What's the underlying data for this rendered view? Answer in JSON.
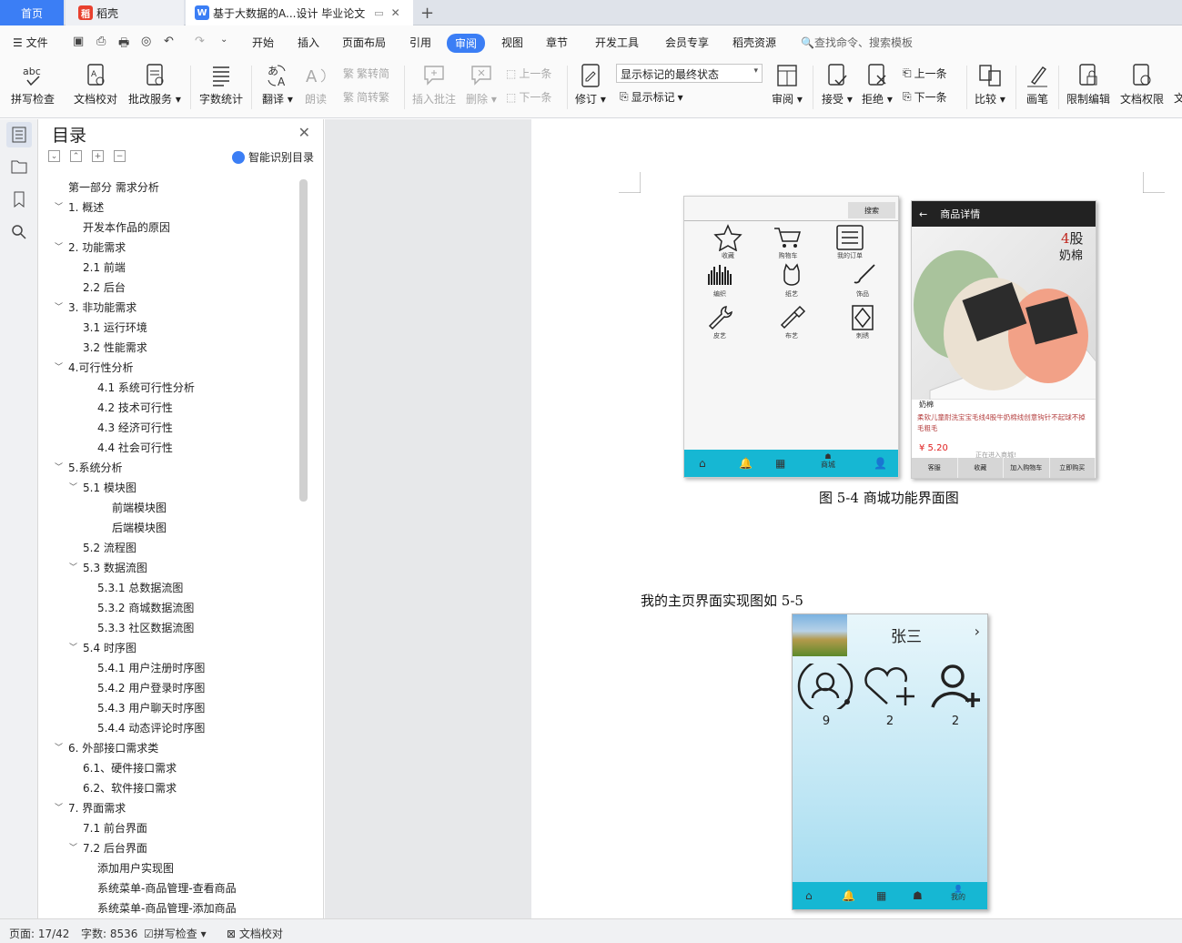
{
  "tabs": {
    "home": "首页",
    "docer": "稻壳",
    "doc": "基于大数据的A...设计 毕业论文",
    "new_tab": "+"
  },
  "menu": {
    "file": "文件",
    "items": [
      "开始",
      "插入",
      "页面布局",
      "引用",
      "审阅",
      "视图",
      "章节",
      "开发工具",
      "会员专享",
      "稻壳资源"
    ],
    "search_placeholder": "查找命令、搜索模板"
  },
  "ribbon": {
    "spell": "拼写检查",
    "proof": "文档校对",
    "batch": "批改服务",
    "wordcount": "字数统计",
    "translate": "翻译",
    "read": "朗读",
    "s2t": "繁转简",
    "t2s": "简转繁",
    "insert_comment": "插入批注",
    "delete": "删除",
    "prev_comment": "上一条",
    "next_comment": "下一条",
    "revise": "修订",
    "markup_state": "显示标记的最终状态",
    "show_markup": "显示标记",
    "review": "审阅",
    "accept": "接受",
    "reject": "拒绝",
    "prev_change": "上一条",
    "next_change": "下一条",
    "compare": "比较",
    "pen": "画笔",
    "restrict": "限制编辑",
    "permission": "文档权限",
    "more": "文"
  },
  "nav": {
    "title": "目录",
    "smart": "智能识别目录",
    "toc": [
      {
        "text": "第一部分  需求分析",
        "level": 0,
        "exp": ""
      },
      {
        "text": "1.  概述",
        "level": 0,
        "exp": "v"
      },
      {
        "text": "开发本作品的原因",
        "level": 1,
        "exp": ""
      },
      {
        "text": "2.  功能需求",
        "level": 0,
        "exp": "v"
      },
      {
        "text": "2.1  前端",
        "level": 1,
        "exp": ""
      },
      {
        "text": "2.2  后台",
        "level": 1,
        "exp": ""
      },
      {
        "text": "3.  非功能需求",
        "level": 0,
        "exp": "v"
      },
      {
        "text": "3.1  运行环境",
        "level": 1,
        "exp": ""
      },
      {
        "text": "3.2  性能需求",
        "level": 1,
        "exp": ""
      },
      {
        "text": "4.可行性分析",
        "level": 0,
        "exp": "v"
      },
      {
        "text": "4.1  系统可行性分析",
        "level": 2,
        "exp": ""
      },
      {
        "text": "4.2  技术可行性",
        "level": 2,
        "exp": ""
      },
      {
        "text": "4.3  经济可行性",
        "level": 2,
        "exp": ""
      },
      {
        "text": "4.4  社会可行性",
        "level": 2,
        "exp": ""
      },
      {
        "text": "5.系统分析",
        "level": 0,
        "exp": "v"
      },
      {
        "text": "5.1  模块图",
        "level": 1,
        "exp": "v"
      },
      {
        "text": "前端模块图",
        "level": 3,
        "exp": ""
      },
      {
        "text": "后端模块图",
        "level": 3,
        "exp": ""
      },
      {
        "text": "5.2  流程图",
        "level": 1,
        "exp": ""
      },
      {
        "text": "5.3  数据流图",
        "level": 1,
        "exp": "v"
      },
      {
        "text": "5.3.1  总数据流图",
        "level": 2,
        "exp": ""
      },
      {
        "text": "5.3.2  商城数据流图",
        "level": 2,
        "exp": ""
      },
      {
        "text": "5.3.3  社区数据流图",
        "level": 2,
        "exp": ""
      },
      {
        "text": "5.4  时序图",
        "level": 1,
        "exp": "v"
      },
      {
        "text": "5.4.1  用户注册时序图",
        "level": 2,
        "exp": ""
      },
      {
        "text": "5.4.2  用户登录时序图",
        "level": 2,
        "exp": ""
      },
      {
        "text": "5.4.3  用户聊天时序图",
        "level": 2,
        "exp": ""
      },
      {
        "text": "5.4.4  动态评论时序图",
        "level": 2,
        "exp": ""
      },
      {
        "text": "6.  外部接口需求类",
        "level": 0,
        "exp": "v"
      },
      {
        "text": "6.1、硬件接口需求",
        "level": 1,
        "exp": ""
      },
      {
        "text": "6.2、软件接口需求",
        "level": 1,
        "exp": ""
      },
      {
        "text": "7.  界面需求",
        "level": 0,
        "exp": "v"
      },
      {
        "text": "7.1  前台界面",
        "level": 1,
        "exp": ""
      },
      {
        "text": "7.2  后台界面",
        "level": 1,
        "exp": "v"
      },
      {
        "text": "添加用户实现图",
        "level": 2,
        "exp": ""
      },
      {
        "text": "系统菜单-商品管理-查看商品",
        "level": 2,
        "exp": ""
      },
      {
        "text": "系统菜单-商品管理-添加商品",
        "level": 2,
        "exp": ""
      }
    ]
  },
  "page": {
    "caption_54": "图 5-4 商城功能界面图",
    "para_55": "我的主页界面实现图如 5-5",
    "mall": {
      "search": "搜索",
      "categories": [
        "收藏",
        "购物车",
        "我的订单",
        "编织",
        "纸艺",
        "饰品",
        "皮艺",
        "布艺",
        "刺绣"
      ],
      "bottom_label": "商城"
    },
    "detail": {
      "title": "商品详情",
      "brand": "4股\n奶棉",
      "name": "奶棉",
      "desc": "柔软儿童耐洗宝宝毛线4股牛奶棉线创意钩针不起球不掉毛粗毛",
      "price": "¥    5.20",
      "toast": "正在进入商城!",
      "buttons": [
        "客服",
        "收藏",
        "加入购物车",
        "立即购买"
      ]
    },
    "profile": {
      "name": "张三",
      "stats": [
        "9",
        "2",
        "2"
      ],
      "bottom_label": "我的"
    }
  },
  "status": {
    "page": "页面: 17/42",
    "words": "字数: 8536",
    "spell": "拼写检查",
    "proof": "文档校对"
  }
}
